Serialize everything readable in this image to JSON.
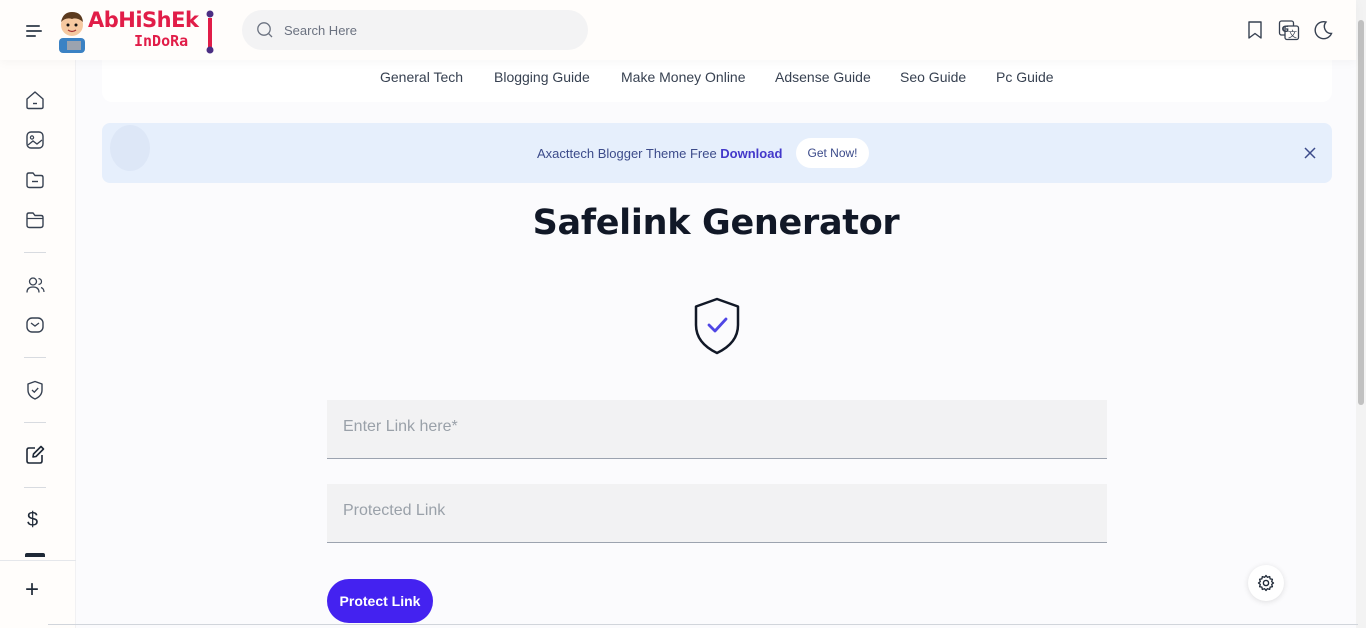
{
  "header": {
    "logo_main": "AbHiShEk",
    "logo_sub": "InDoRa",
    "search_placeholder": "Search Here"
  },
  "nav": {
    "items": [
      "General Tech",
      "Blogging Guide",
      "Make Money Online",
      "Adsense Guide",
      "Seo Guide",
      "Pc Guide"
    ]
  },
  "banner": {
    "text": "Axacttech Blogger Theme Free ",
    "text_bold": "Download",
    "button": "Get Now!"
  },
  "main": {
    "title": "Safelink Generator",
    "input_placeholder": "Enter Link here*",
    "output_placeholder": "Protected Link",
    "button": "Protect Link"
  },
  "sidebar": {
    "dollar": "$",
    "plus": "+"
  },
  "colors": {
    "accent": "#4422f0",
    "logo": "#e11d48",
    "banner_bg": "#e6effc",
    "shield_check": "#4f46e5"
  }
}
